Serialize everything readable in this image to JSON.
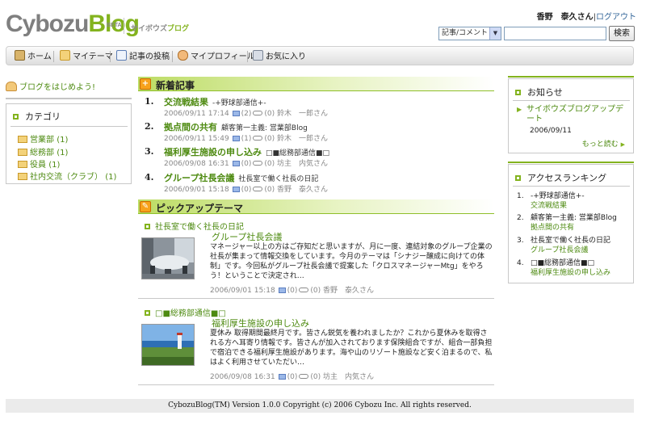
{
  "header": {
    "logo_part1": "Cybozu",
    "logo_part2": "Blog",
    "beta": "BETA",
    "subtitle_part1": "サイボウズ",
    "subtitle_part2": "ブログ",
    "user_name": "香野　泰久さん",
    "separator": "|",
    "logout_label": "ログアウト",
    "search_scope": "記事/コメント",
    "search_value": "",
    "search_button": "検索"
  },
  "nav": [
    {
      "label": "ホーム",
      "icon": "home-icon"
    },
    {
      "label": "マイテーマ",
      "icon": "folder-icon"
    },
    {
      "label": "記事の投稿",
      "icon": "pencil-icon"
    },
    {
      "label": "マイプロフィール",
      "icon": "user-icon"
    },
    {
      "label": "お気に入り",
      "icon": "favorites-icon"
    }
  ],
  "sidebar": {
    "start_blog": "ブログをはじめよう!",
    "category_title": "カテゴリ",
    "categories": [
      {
        "label": "営業部",
        "count": "(1)"
      },
      {
        "label": "総務部",
        "count": "(1)"
      },
      {
        "label": "役員",
        "count": "(1)"
      },
      {
        "label": "社内交流（クラブ）",
        "count": "(1)"
      }
    ]
  },
  "new_entries": {
    "title": "新着記事",
    "items": [
      {
        "num": "1.",
        "title": "交流戦結果",
        "blog": "-+野球部通信+-",
        "date": "2006/09/11 17:14",
        "comments": "(2)",
        "trackbacks": "(0)",
        "author": "鈴木　一郎さん"
      },
      {
        "num": "2.",
        "title": "拠点間の共有",
        "blog": "顧客第一主義: 営業部Blog",
        "date": "2006/09/11 15:49",
        "comments": "(1)",
        "trackbacks": "(0)",
        "author": "鈴木　一郎さん"
      },
      {
        "num": "3.",
        "title": "福利厚生施設の申し込み",
        "blog": "□■総務部通信■□",
        "date": "2006/09/08 16:31",
        "comments": "(0)",
        "trackbacks": "(0)",
        "author": "坊主　内気さん"
      },
      {
        "num": "4.",
        "title": "グループ社長会議",
        "blog": "社長室で働く社長の日記",
        "date": "2006/09/01 15:18",
        "comments": "(0)",
        "trackbacks": "(0)",
        "author": "香野　泰久さん"
      }
    ]
  },
  "pickup": {
    "title": "ピックアップテーマ",
    "items": [
      {
        "blog": "社長室で働く社長の日記",
        "title": "グループ社長会議",
        "body": "マネージャー以上の方はご存知だと思いますが、月に一度、連結対象のグループ企業の社長が集まって情報交換をしています。今月のテーマは「シナジー醸成に向けての体制」です。今回私がグループ社長会議で提案した「クロスマネージャーMtg」をやろう！ということで決定され…",
        "date": "2006/09/01 15:18",
        "comments": "(0)",
        "trackbacks": "(0)",
        "author": "香野　泰久さん"
      },
      {
        "blog": "□■総務部通信■□",
        "title": "福利厚生施設の申し込み",
        "body": "夏休み 取得期間最終月です。皆さん鋭気を養われましたか？これから夏休みを取得される方へ耳寄り情報です。皆さんが加入されております保険組合ですが、組合一部負担で宿泊できる福利厚生施設があります。海や山のリゾート施設など安く泊まるので、私はよく利用させていただい…",
        "date": "2006/09/08 16:31",
        "comments": "(0)",
        "trackbacks": "(0)",
        "author": "坊主　内気さん"
      }
    ]
  },
  "news": {
    "title": "お知らせ",
    "link": "サイボウズブログアップデート",
    "date": "2006/09/11",
    "more": "もっと読む"
  },
  "ranking": {
    "title": "アクセスランキング",
    "items": [
      {
        "num": "1.",
        "blog": "-+野球部通信+-",
        "entry": "交流戦結果"
      },
      {
        "num": "2.",
        "blog": "顧客第一主義: 営業部Blog",
        "entry": "拠点間の共有"
      },
      {
        "num": "3.",
        "blog": "社長室で働く社長の日記",
        "entry": "グループ社長会議"
      },
      {
        "num": "4.",
        "blog": "□■総務部通信■□",
        "entry": "福利厚生施設の申し込み"
      }
    ]
  },
  "footer": {
    "text": "CybozuBlog(TM) Version 1.0.0  Copyright (c) 2006 Cybozu Inc. All rights reserved."
  }
}
